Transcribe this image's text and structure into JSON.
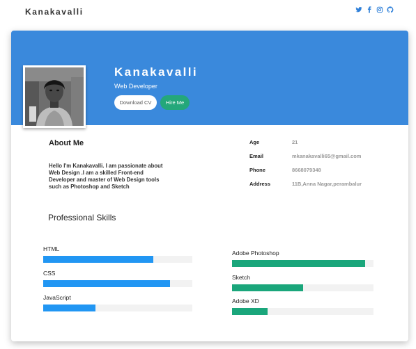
{
  "nav": {
    "brand": "Kanakavalli",
    "social": [
      {
        "icon": "twitter-icon"
      },
      {
        "icon": "facebook-icon"
      },
      {
        "icon": "instagram-icon"
      },
      {
        "icon": "github-icon"
      }
    ]
  },
  "profile": {
    "name": "Kanakavalli",
    "role": "Web Developer",
    "download_label": "Download CV",
    "hire_label": "Hire Me"
  },
  "about": {
    "title": "About Me",
    "text": "Hello I'm Kanakavalli. I am passionate about Web Design .I am a skilled Front-end Developer and master of Web Design tools such as Photoshop and Sketch"
  },
  "info": [
    {
      "label": "Age",
      "value": "21"
    },
    {
      "label": "Email",
      "value": "mkanakavalli65@gmail.com"
    },
    {
      "label": "Phone",
      "value": "8668079348"
    },
    {
      "label": "Address",
      "value": "11B,Anna Nagar,perambalur"
    }
  ],
  "skills": {
    "title": "Professional Skills",
    "left": [
      {
        "name": "HTML",
        "level": 0.74
      },
      {
        "name": "CSS",
        "level": 0.85
      },
      {
        "name": "JavaScript",
        "level": 0.35
      }
    ],
    "right": [
      {
        "name": "Adobe Photoshop",
        "level": 0.94
      },
      {
        "name": "Sketch",
        "level": 0.5
      },
      {
        "name": "Adobe XD",
        "level": 0.25
      }
    ]
  },
  "colors": {
    "hero": "#3a89dc",
    "hire_button": "#24a77a",
    "bar_blue": "#2196f3",
    "bar_green": "#1aa67b",
    "track": "#f2f2f2"
  }
}
